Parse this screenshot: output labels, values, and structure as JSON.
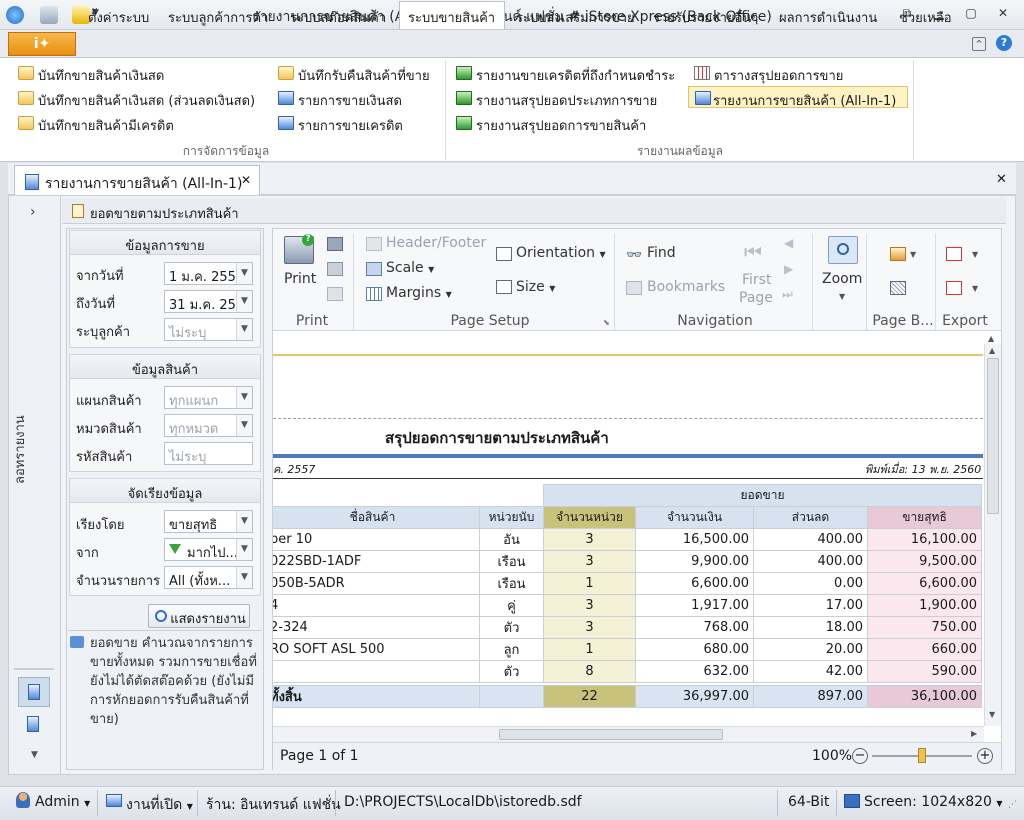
{
  "window": {
    "title": "รายงานการขายสินค้า (All-In-1) - อินเทรนด์ แฟชั่น # iStore Xpress (Back Office)"
  },
  "tabs": [
    "ตั้งค่าระบบ",
    "ระบบลูกค้าการค้า",
    "ระบบสต๊อคสินค้า",
    "ระบบขายสินค้า",
    "ระบบส่งเสริมการขาย",
    "รายรับรายจ่ายอื่นๆ",
    "ผลการดำเนินงาน",
    "ช่วยเหลือ"
  ],
  "ribbon": {
    "col1": [
      "บันทึกขายสินค้าเงินสด",
      "บันทึกขายสินค้าเงินสด (ส่วนลดเงินสด)",
      "บันทึกขายสินค้ามีเครดิต"
    ],
    "col2": [
      "บันทึกรับคืนสินค้าที่ขาย",
      "รายการขายเงินสด",
      "รายการขายเครดิต"
    ],
    "col3": [
      "รายงานขายเครดิตที่ถึงกำหนดชำระ",
      "รายงานสรุปยอดประเภทการขาย",
      "รายงานสรุปยอดการขายสินค้า"
    ],
    "col4": [
      "ตารางสรุปยอดการขาย",
      "รายงานการขายสินค้า (All-In-1)"
    ],
    "group1": "การจัดการข้อมูล",
    "group2": "รายงานผลข้อมูล"
  },
  "doc_tab": "รายงานการขายสินค้า (All-In-1)",
  "left_strip": {
    "label": "ลอทรายงาน"
  },
  "panel_title": "ยอดขายตามประเภทสินค้า",
  "filters": {
    "sales_head": "ข้อมูลการขาย",
    "from_label": "จากวันที่",
    "from_value": "1 ม.ค. 2557",
    "to_label": "ถึงวันที่",
    "to_value": "31 ม.ค. 2557",
    "cust_label": "ระบุลูกค้า",
    "cust_value": "ไม่ระบุ",
    "prod_head": "ข้อมูลสินค้า",
    "dept_label": "แผนกสินค้า",
    "dept_value": "ทุกแผนก",
    "cat_label": "หมวดสินค้า",
    "cat_value": "ทุกหมวด",
    "code_label": "รหัสสินค้า",
    "code_value": "ไม่ระบุ",
    "sort_head": "จัดเรียงข้อมูล",
    "sortby_label": "เรียงโดย",
    "sortby_value": "ขายสุทธิ",
    "order_label": "จาก",
    "order_value": "มากไป...",
    "count_label": "จำนวนรายการ",
    "count_value": "All (ทั้งห...",
    "show_button": "แสดงรายงาน",
    "note": "ยอดขาย คำนวณจากรายการขายทั้งหมด รวมการขายเชื่อที่ยังไม่ได้ตัดสต๊อคด้วย (ยังไม่มีการหักยอดการรับคืนสินค้าที่ขาย)"
  },
  "toolbar": {
    "print": "Print",
    "print_group": "Print",
    "header_footer": "Header/Footer",
    "scale": "Scale",
    "margins": "Margins",
    "orientation": "Orientation",
    "size": "Size",
    "page_setup_group": "Page Setup",
    "find": "Find",
    "bookmarks": "Bookmarks",
    "first_page_1": "First",
    "first_page_2": "Page",
    "navigation_group": "Navigation",
    "zoom": "Zoom",
    "page_b_group": "Page B...",
    "export_group": "Export"
  },
  "report": {
    "title": "สรุปยอดการขายตามประเภทสินค้า",
    "date_left": "ค. 2557",
    "printed": "พิมพ์เมื่อ: 13 พ.ย. 2560",
    "group_header": "ยอดขาย",
    "columns": [
      "ชื่อสินค้า",
      "หน่วยนับ",
      "จำนวนหน่วย",
      "จำนวนเงิน",
      "ส่วนลด",
      "ขายสุทธิ"
    ],
    "rows": [
      [
        "per 10",
        "อัน",
        "3",
        "16,500.00",
        "400.00",
        "16,100.00"
      ],
      [
        "022SBD-1ADF",
        "เรือน",
        "3",
        "9,900.00",
        "400.00",
        "9,500.00"
      ],
      [
        "050B-5ADR",
        "เรือน",
        "1",
        "6,600.00",
        "0.00",
        "6,600.00"
      ],
      [
        "4",
        "คู่",
        "3",
        "1,917.00",
        "17.00",
        "1,900.00"
      ],
      [
        "2-324",
        "ตัว",
        "3",
        "768.00",
        "18.00",
        "750.00"
      ],
      [
        "RO SOFT ASL 500",
        "ลูก",
        "1",
        "680.00",
        "20.00",
        "660.00"
      ],
      [
        "",
        "ตัว",
        "8",
        "632.00",
        "42.00",
        "590.00"
      ]
    ],
    "total": [
      "ทั้งสิ้น",
      "",
      "22",
      "36,997.00",
      "897.00",
      "36,100.00"
    ]
  },
  "viewer_status": {
    "page": "Page 1 of 1",
    "zoom": "100%"
  },
  "statusbar": {
    "user": "Admin",
    "open": "งานที่เปิด",
    "store": "ร้าน: อินเทรนด์ แฟชั่น",
    "db": "D:\\PROJECTS\\LocalDb\\istoredb.sdf",
    "bits": "64-Bit",
    "screen": "Screen: 1024x820"
  },
  "colors": {
    "accent": "#e88f12",
    "header_blue": "#d6e2f0",
    "units_col": "#f4f1d6",
    "net_col": "#fbe8ee",
    "total_row": "#d9e4f2"
  }
}
